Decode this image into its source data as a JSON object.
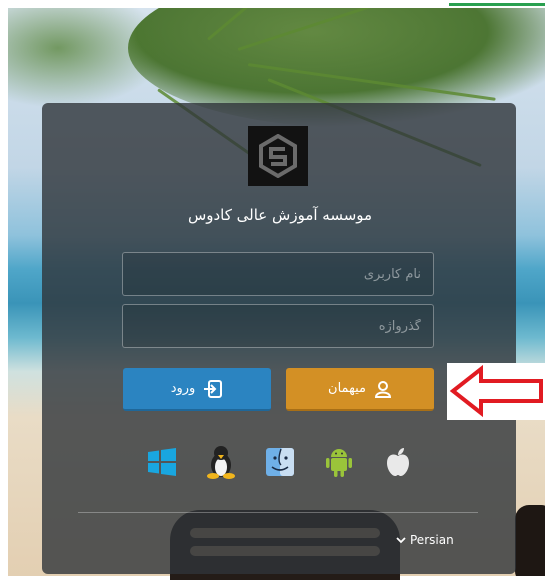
{
  "window": {
    "title": "موسسه آموزش عالی کادوس"
  },
  "login": {
    "username_placeholder": "نام کاربری",
    "password_placeholder": "گذرواژه",
    "login_label": "ورود",
    "guest_label": "میهمان"
  },
  "os_icons": [
    "windows-icon",
    "linux-icon",
    "finder-icon",
    "android-icon",
    "apple-icon"
  ],
  "language": {
    "selected": "Persian"
  },
  "colors": {
    "login_button": "#2b84c1",
    "guest_button": "#d39025",
    "panel": "#30343a",
    "annotation_arrow": "#e11b22"
  }
}
